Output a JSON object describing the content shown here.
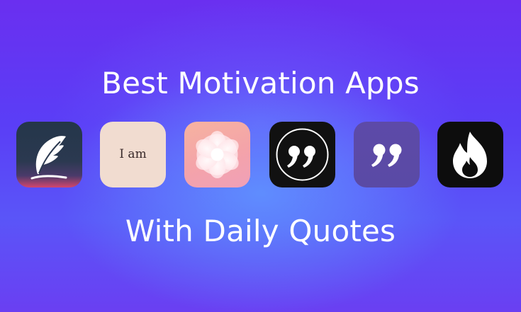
{
  "headline": {
    "top": "Best Motivation Apps",
    "bottom": "With Daily Quotes"
  },
  "apps": [
    {
      "icon": "feather-icon"
    },
    {
      "icon": "i-am-text-icon",
      "label": "I am"
    },
    {
      "icon": "swirl-flower-icon"
    },
    {
      "icon": "quote-marks-circle-icon"
    },
    {
      "icon": "quote-marks-icon"
    },
    {
      "icon": "flame-icon"
    }
  ],
  "colors": {
    "background": "#5a3ef6",
    "text": "#ffffff"
  }
}
